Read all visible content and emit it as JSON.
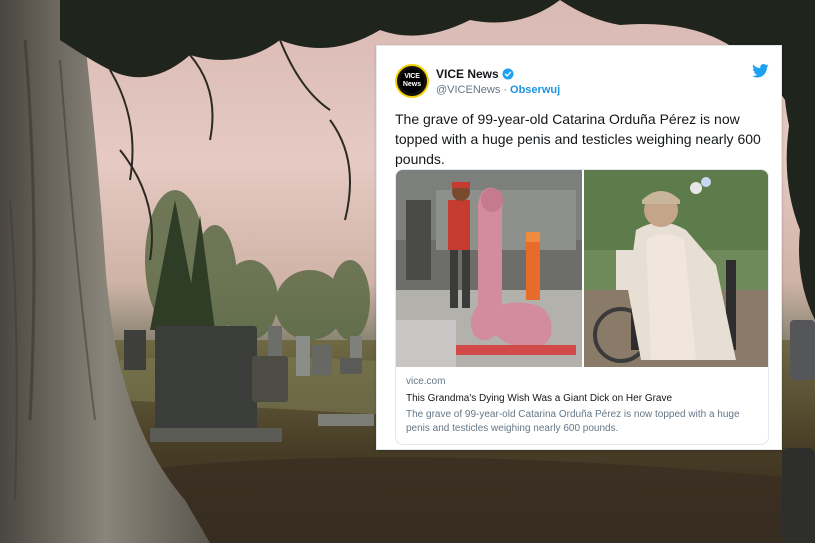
{
  "tweet": {
    "account_name": "VICE News",
    "avatar_text_top": "VICE",
    "avatar_text_bottom": "News",
    "handle": "@VICENews",
    "separator": "·",
    "follow_label": "Obserwuj",
    "text": "The grave of 99-year-old Catarina Orduña Pérez is now topped with a huge penis and testicles weighing nearly 600 pounds.",
    "card": {
      "domain": "vice.com",
      "title": "This Grandma's Dying Wish Was a Giant Dick on Her Grave",
      "description": "The grave of 99-year-old Catarina Orduña Pérez is now topped with a huge penis and testicles weighing nearly 600 pounds."
    }
  },
  "icons": {
    "verified": "verified-badge-icon",
    "platform": "twitter-bird-icon"
  },
  "colors": {
    "twitter_blue": "#1da1f2",
    "link_blue": "#1b95e0",
    "text_dark": "#14171a",
    "text_muted": "#657786"
  }
}
